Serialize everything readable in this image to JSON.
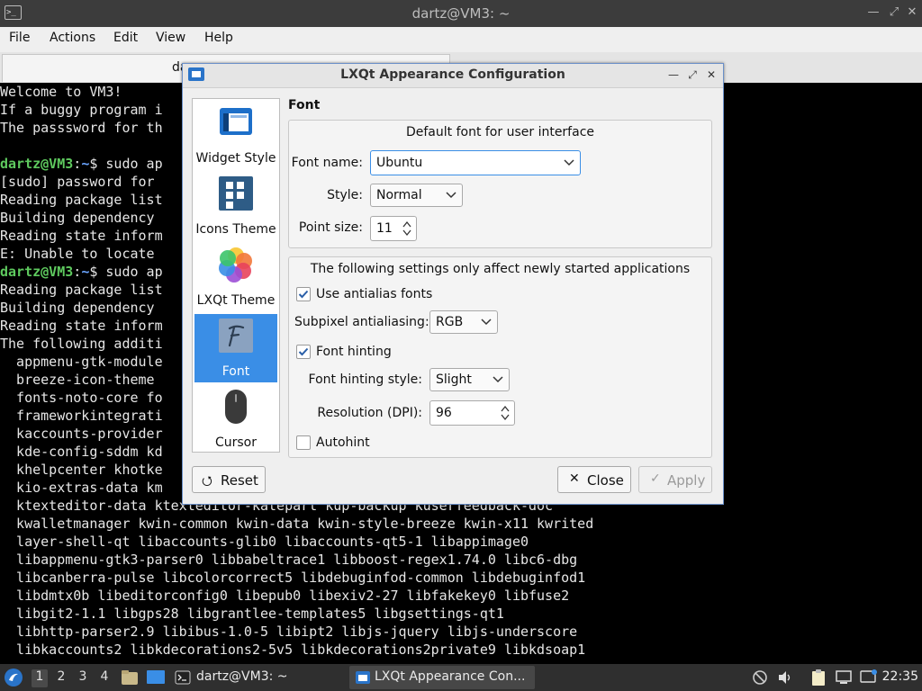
{
  "terminal": {
    "title": "dartz@VM3: ~",
    "menu": [
      "File",
      "Actions",
      "Edit",
      "View",
      "Help"
    ],
    "tab_label": "dartz@VM3: ~",
    "tab_visible": "dar",
    "lines": [
      {
        "text": "Welcome to VM3!"
      },
      {
        "text": "If a buggy program i"
      },
      {
        "text": "The passsword for th"
      },
      {
        "text": ""
      },
      {
        "user": "dartz@VM3",
        "path": "~",
        "text": "$ sudo ap"
      },
      {
        "text": "[sudo] password for "
      },
      {
        "text": "Reading package list"
      },
      {
        "text": "Building dependency "
      },
      {
        "text": "Reading state inform"
      },
      {
        "text": "E: Unable to locate "
      },
      {
        "user": "dartz@VM3",
        "path": "~",
        "text": "$ sudo ap"
      },
      {
        "text": "Reading package list"
      },
      {
        "text": "Building dependency "
      },
      {
        "text": "Reading state inform"
      },
      {
        "text": "The following additi"
      },
      {
        "text": "  appmenu-gtk-module"
      },
      {
        "text": "  breeze-icon-theme "
      },
      {
        "text": "  fonts-noto-core fo"
      },
      {
        "text": "  frameworkintegrati"
      },
      {
        "text": "  kaccounts-provider"
      },
      {
        "text": "  kde-config-sddm kd"
      },
      {
        "text": "  khelpcenter khotke"
      },
      {
        "text": "  kio-extras-data km"
      },
      {
        "text": "  ktexteditor-data ktexteditor-katepart kup-backup kuserfeedback-doc"
      },
      {
        "text": "  kwalletmanager kwin-common kwin-data kwin-style-breeze kwin-x11 kwrited"
      },
      {
        "text": "  layer-shell-qt libaccounts-glib0 libaccounts-qt5-1 libappimage0"
      },
      {
        "text": "  libappmenu-gtk3-parser0 libbabeltrace1 libboost-regex1.74.0 libc6-dbg"
      },
      {
        "text": "  libcanberra-pulse libcolorcorrect5 libdebuginfod-common libdebuginfod1"
      },
      {
        "text": "  libdmtx0b libeditorconfig0 libepub0 libexiv2-27 libfakekey0 libfuse2"
      },
      {
        "text": "  libgit2-1.1 libgps28 libgrantlee-templates5 libgsettings-qt1"
      },
      {
        "text": "  libhttp-parser2.9 libibus-1.0-5 libipt2 libjs-jquery libjs-underscore"
      },
      {
        "text": "  libkaccounts2 libkdecorations2-5v5 libkdecorations2private9 libkdsoap1"
      }
    ]
  },
  "dialog": {
    "title": "LXQt Appearance Configuration",
    "sidebar": [
      {
        "label": "Widget Style",
        "icon": "widget-style-icon",
        "selected": false
      },
      {
        "label": "Icons Theme",
        "icon": "icons-theme-icon",
        "selected": false
      },
      {
        "label": "LXQt Theme",
        "icon": "lxqt-theme-icon",
        "selected": false
      },
      {
        "label": "Font",
        "icon": "font-icon",
        "selected": true
      },
      {
        "label": "Cursor",
        "icon": "cursor-icon",
        "selected": false
      }
    ],
    "section_title": "Font",
    "group1": {
      "title": "Default font for user interface",
      "font_name_label": "Font name:",
      "font_name_value": "Ubuntu",
      "style_label": "Style:",
      "style_value": "Normal",
      "point_size_label": "Point size:",
      "point_size_value": "11"
    },
    "group2": {
      "title": "The following settings only affect newly started applications",
      "antialias_label": "Use antialias fonts",
      "antialias_checked": true,
      "subpixel_label": "Subpixel antialiasing:",
      "subpixel_value": "RGB",
      "hinting_label": "Font hinting",
      "hinting_checked": true,
      "hinting_style_label": "Font hinting style:",
      "hinting_style_value": "Slight",
      "resolution_label": "Resolution (DPI):",
      "resolution_value": "96",
      "autohint_label": "Autohint",
      "autohint_checked": false
    },
    "buttons": {
      "reset": "Reset",
      "close": "Close",
      "apply": "Apply"
    }
  },
  "taskbar": {
    "workspaces": [
      "1",
      "2",
      "3",
      "4"
    ],
    "active_workspace": "1",
    "tasks": [
      {
        "label": "dartz@VM3: ~",
        "active": false
      },
      {
        "label": "LXQt Appearance Con...",
        "active": true
      }
    ],
    "clock": "22:35"
  },
  "colors": {
    "accent": "#3a8ee6",
    "prompt_user": "#5ec95e",
    "prompt_path": "#6ba5ff"
  }
}
